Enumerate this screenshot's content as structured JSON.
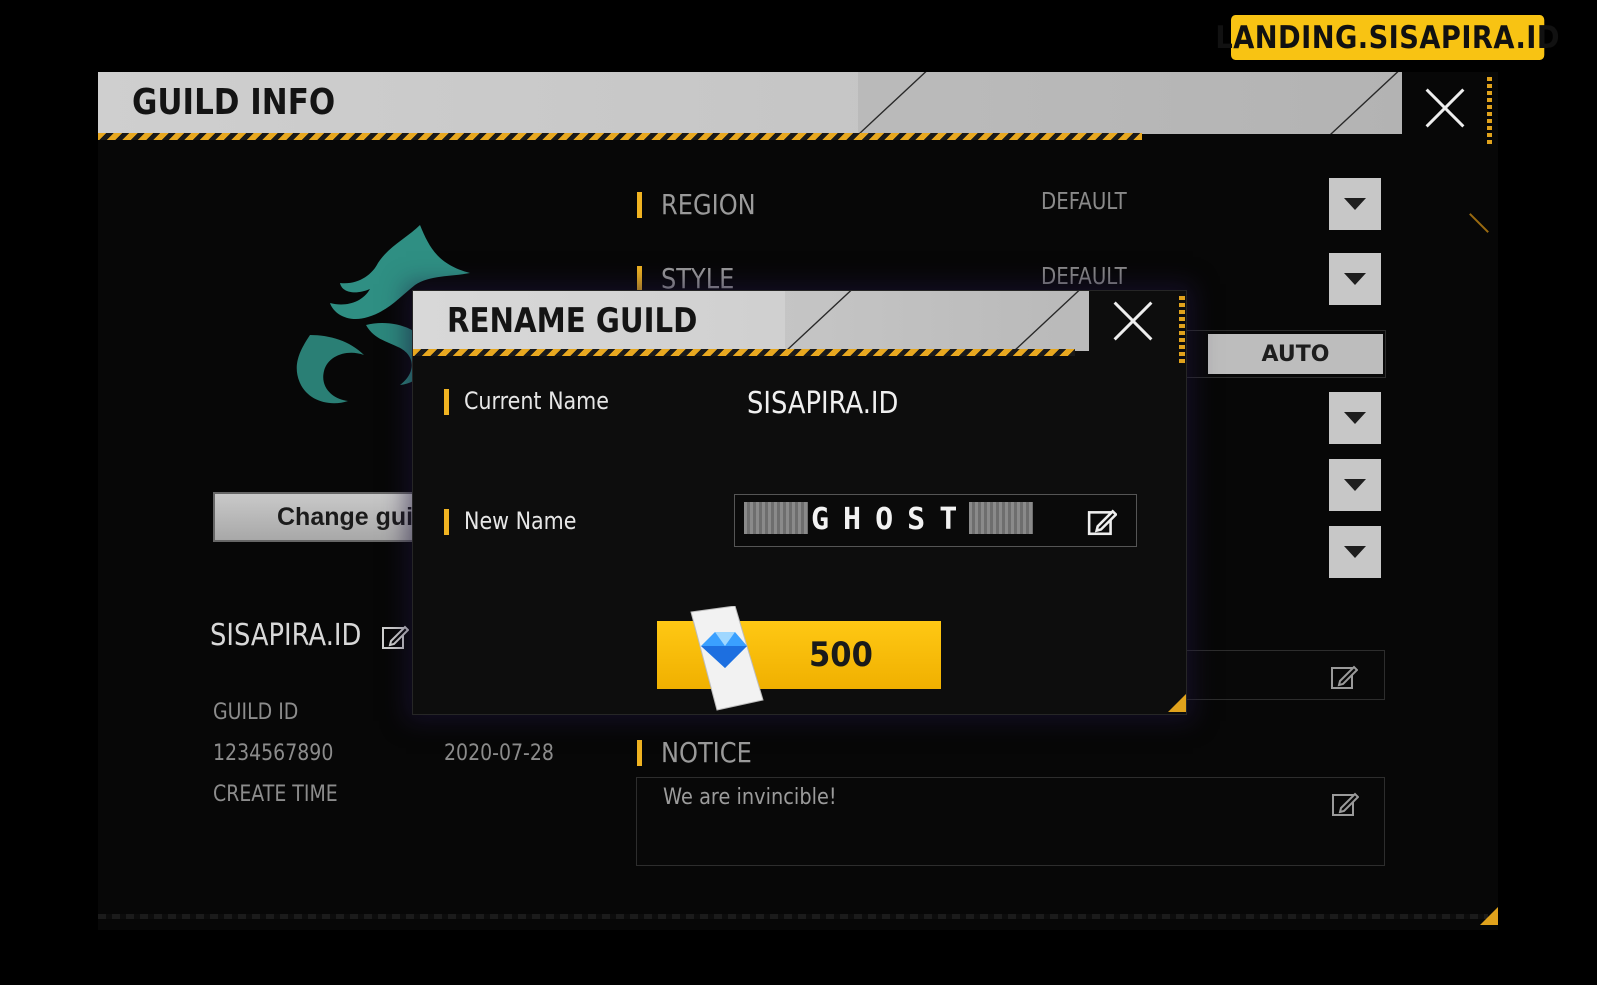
{
  "watermark": "LANDING.SISAPIRA.ID",
  "guild_info": {
    "title": "GUILD INFO",
    "change_button": "Change guild",
    "guild_name": "SISAPIRA.ID",
    "guild_id_label": "GUILD ID",
    "guild_id_value": "1234567890",
    "create_time_label": "CREATE TIME",
    "create_time_value": "2020-07-28",
    "region_label": "REGION",
    "region_value": "DEFAULT",
    "style_label": "STYLE",
    "style_value": "DEFAULT",
    "auto_button": "AUTO",
    "notice_label": "NOTICE",
    "notice_text": "We are invincible!"
  },
  "rename_modal": {
    "title": "RENAME GUILD",
    "current_name_label": "Current Name",
    "current_name_value": "SISAPIRA.ID",
    "new_name_label": "New Name",
    "new_name_value": "GHOST",
    "price": "500"
  },
  "colors": {
    "accent": "#f0b321",
    "button_yellow": "#ffc814",
    "header_gray": "#cfcfcf"
  },
  "icons": [
    "close-icon",
    "edit-icon",
    "chevron-down-icon",
    "diamond-icon",
    "dragon-logo"
  ]
}
